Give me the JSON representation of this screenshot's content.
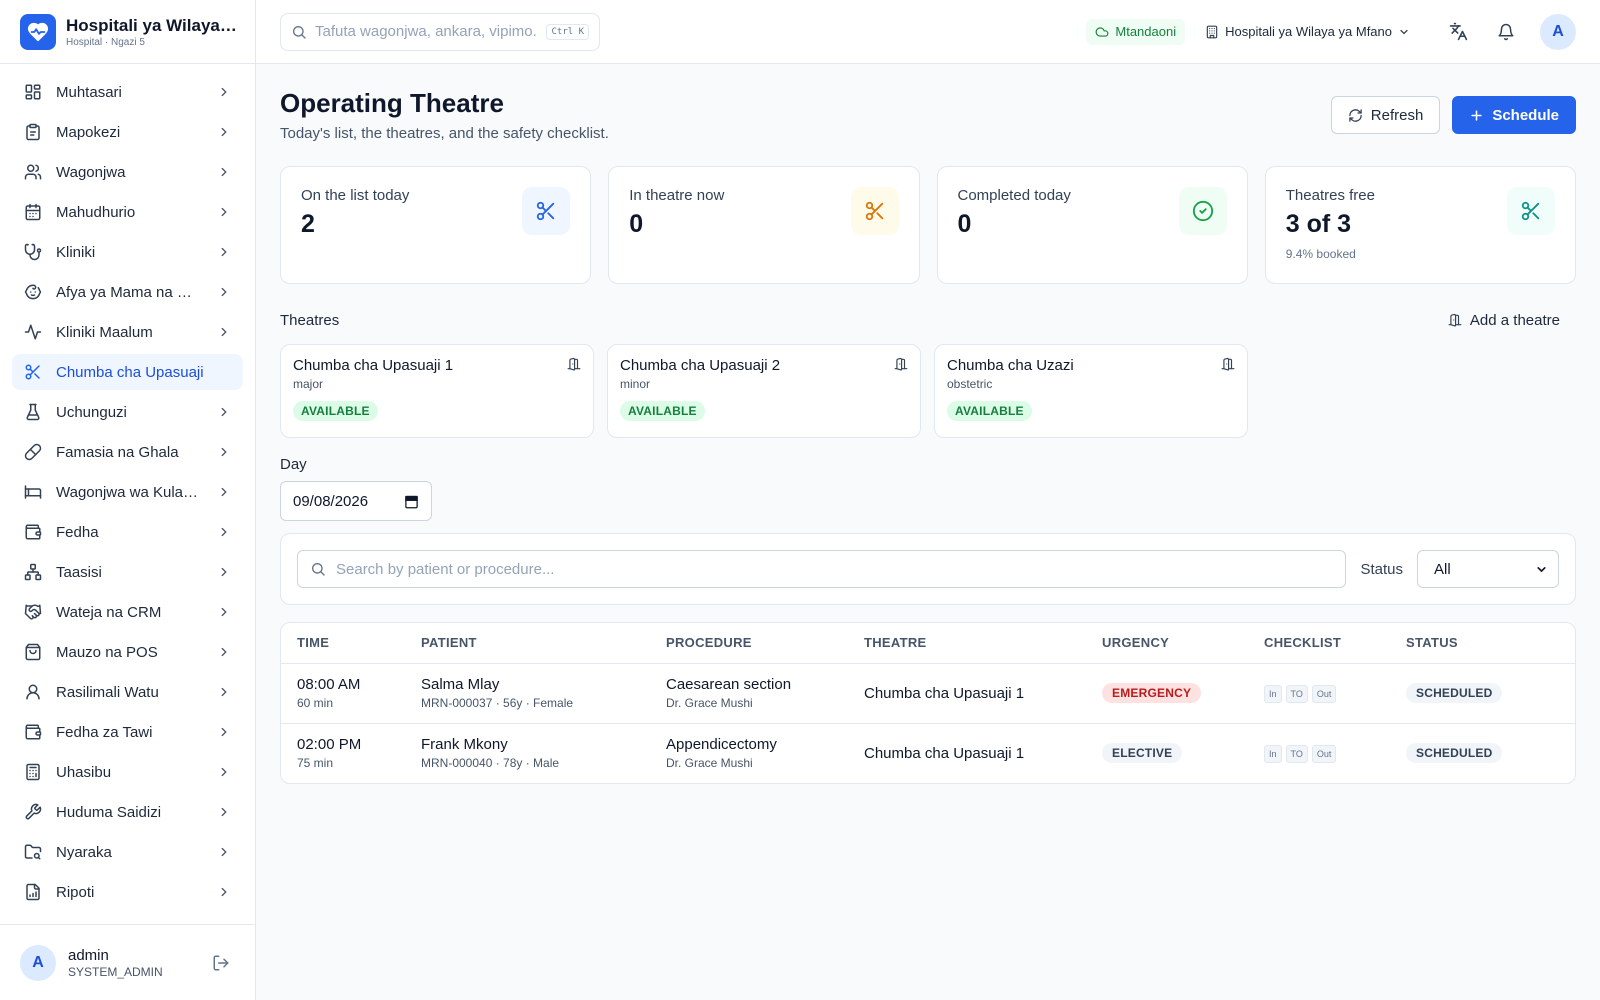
{
  "brand": {
    "title": "Hospitali ya Wilaya ya Mfano",
    "subtitle": "Hospital · Ngazi 5",
    "logo_icon": "heart-pulse-icon",
    "accent": "#2563eb"
  },
  "sidebar": {
    "items": [
      {
        "label": "Muhtasari",
        "icon": "dashboard-icon"
      },
      {
        "label": "Mapokezi",
        "icon": "clipboard-icon"
      },
      {
        "label": "Wagonjwa",
        "icon": "users-icon"
      },
      {
        "label": "Mahudhurio",
        "icon": "calendar-icon"
      },
      {
        "label": "Kliniki",
        "icon": "stethoscope-icon"
      },
      {
        "label": "Afya ya Mama na Mtoto",
        "icon": "baby-icon"
      },
      {
        "label": "Kliniki Maalum",
        "icon": "activity-icon"
      },
      {
        "label": "Chumba cha Upasuaji",
        "icon": "scissors-icon",
        "active": true
      },
      {
        "label": "Uchunguzi",
        "icon": "flask-icon"
      },
      {
        "label": "Famasia na Ghala",
        "icon": "pill-icon"
      },
      {
        "label": "Wagonjwa wa Kulazwa",
        "icon": "bed-icon"
      },
      {
        "label": "Fedha",
        "icon": "wallet-icon"
      },
      {
        "label": "Taasisi",
        "icon": "network-icon"
      },
      {
        "label": "Wateja na CRM",
        "icon": "handshake-icon"
      },
      {
        "label": "Mauzo na POS",
        "icon": "shopping-bag-icon"
      },
      {
        "label": "Rasilimali Watu",
        "icon": "user-icon"
      },
      {
        "label": "Fedha za Tawi",
        "icon": "wallet-icon"
      },
      {
        "label": "Uhasibu",
        "icon": "calculator-icon"
      },
      {
        "label": "Huduma Saidizi",
        "icon": "wrench-icon"
      },
      {
        "label": "Nyaraka",
        "icon": "folder-search-icon"
      },
      {
        "label": "Ripoti",
        "icon": "report-icon"
      }
    ]
  },
  "user": {
    "initial": "A",
    "name": "admin",
    "role": "SYSTEM_ADMIN"
  },
  "topbar": {
    "search_placeholder": "Tafuta wagonjwa, ankara, vipimo...",
    "shortcut": "Ctrl K",
    "online_label": "Mtandaoni",
    "facility": "Hospitali ya Wilaya ya Mfano",
    "avatar_initial": "A"
  },
  "page": {
    "title": "Operating Theatre",
    "subtitle": "Today's list, the theatres, and the safety checklist.",
    "refresh_label": "Refresh",
    "schedule_label": "Schedule"
  },
  "stats": [
    {
      "label": "On the list today",
      "value": "2",
      "note": "",
      "icon": "scissors-icon",
      "color": "#2563eb"
    },
    {
      "label": "In theatre now",
      "value": "0",
      "note": "",
      "icon": "scissors-icon",
      "color": "#d97706"
    },
    {
      "label": "Completed today",
      "value": "0",
      "note": "",
      "icon": "check-circle-icon",
      "color": "#16a34a"
    },
    {
      "label": "Theatres free",
      "value": "3 of 3",
      "note": "9.4% booked",
      "icon": "scissors-icon",
      "color": "#0d9488"
    }
  ],
  "theatres_section": {
    "title": "Theatres",
    "add_label": "Add a theatre",
    "items": [
      {
        "name": "Chumba cha Upasuaji 1",
        "type": "major",
        "status": "AVAILABLE"
      },
      {
        "name": "Chumba cha Upasuaji 2",
        "type": "minor",
        "status": "AVAILABLE"
      },
      {
        "name": "Chumba cha Uzazi",
        "type": "obstetric",
        "status": "AVAILABLE"
      }
    ]
  },
  "day": {
    "label": "Day",
    "value": "09/08/2026"
  },
  "filters": {
    "search_placeholder": "Search by patient or procedure...",
    "status_label": "Status",
    "status_value": "All"
  },
  "table": {
    "columns": [
      "TIME",
      "PATIENT",
      "PROCEDURE",
      "THEATRE",
      "URGENCY",
      "CHECKLIST",
      "STATUS"
    ],
    "rows": [
      {
        "time": "08:00 AM",
        "duration": "60 min",
        "patient": "Salma Mlay",
        "patient_meta": "MRN-000037 · 56y · Female",
        "procedure": "Caesarean section",
        "surgeon": "Dr. Grace Mushi",
        "theatre": "Chumba cha Upasuaji 1",
        "urgency": "EMERGENCY",
        "checklist": [
          "In",
          "TO",
          "Out"
        ],
        "status": "SCHEDULED"
      },
      {
        "time": "02:00 PM",
        "duration": "75 min",
        "patient": "Frank Mkony",
        "patient_meta": "MRN-000040 · 78y · Male",
        "procedure": "Appendicectomy",
        "surgeon": "Dr. Grace Mushi",
        "theatre": "Chumba cha Upasuaji 1",
        "urgency": "ELECTIVE",
        "checklist": [
          "In",
          "TO",
          "Out"
        ],
        "status": "SCHEDULED"
      }
    ]
  }
}
